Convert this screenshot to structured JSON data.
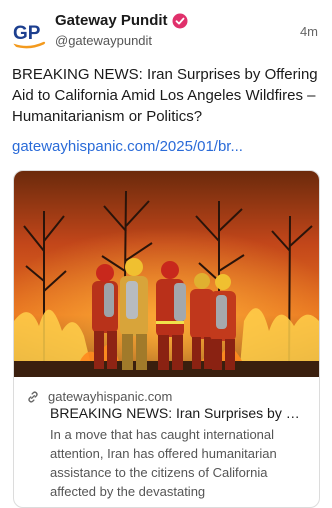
{
  "post": {
    "author_name": "Gateway Pundit",
    "author_handle": "@gatewaypundit",
    "avatar_initials": "GP",
    "time_ago": "4m",
    "text": "BREAKING NEWS: Iran Surprises by Offering Aid to California Amid Los Angeles Wildfires – Humanitarianism or Politics?",
    "link": "gatewayhispanic.com/2025/01/br..."
  },
  "card": {
    "domain": "gatewayhispanic.com",
    "title": "BREAKING NEWS: Iran Surprises by O...",
    "description": "In a move that has caught international attention, Iran has offered humanitarian assistance to the citizens of California affected by the devastating"
  },
  "colors": {
    "link": "#2a6bd8",
    "verified_badge": "#e0306b",
    "avatar_blue": "#1d3f8f",
    "avatar_orange": "#f39a1e"
  },
  "icons": {
    "verified": "verified-badge-icon",
    "link": "link-icon"
  }
}
